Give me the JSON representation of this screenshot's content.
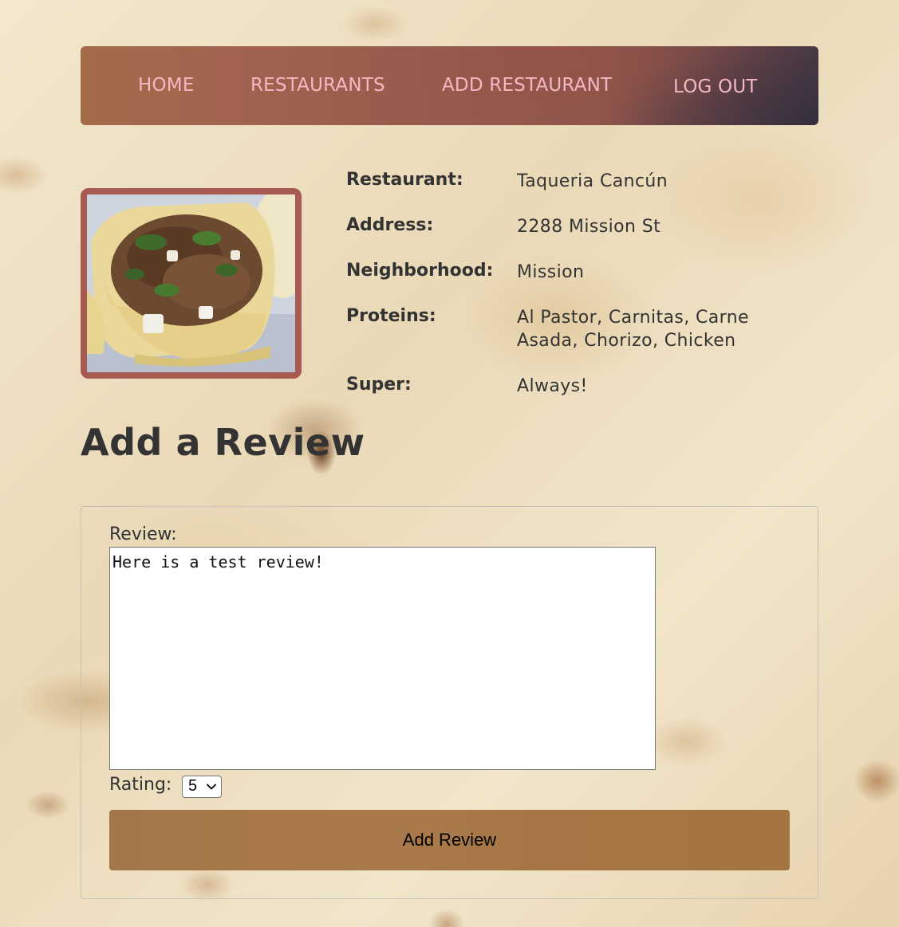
{
  "nav": {
    "home": "HOME",
    "restaurants": "RESTAURANTS",
    "add_restaurant": "ADD RESTAURANT",
    "log_out": "LOG OUT"
  },
  "restaurant": {
    "labels": {
      "name": "Restaurant:",
      "address": "Address:",
      "neighborhood": "Neighborhood:",
      "proteins": "Proteins:",
      "super": "Super:"
    },
    "name": "Taqueria Cancún",
    "address": "2288 Mission St",
    "neighborhood": "Mission",
    "proteins_line1": "Al Pastor, Carnitas, Carne",
    "proteins_line2": "Asada, Chorizo, Chicken",
    "super": "Always!"
  },
  "review_section": {
    "title": "Add a Review"
  },
  "form": {
    "review_label": "Review:",
    "review_value": "Here is a test review!",
    "rating_label": "Rating:",
    "rating_value": "5",
    "submit_label": "Add Review"
  },
  "colors": {
    "nav_link": "#f4b7c4",
    "photo_border": "#a75a52",
    "button": "#a3774a",
    "text": "#333333"
  }
}
